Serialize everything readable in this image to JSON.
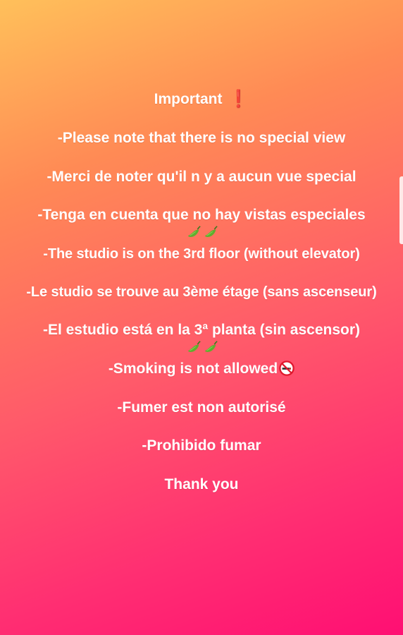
{
  "story": {
    "lines": [
      "Important",
      "-Please note that there is no special view",
      "-Merci de noter qu'il n y a aucun vue special",
      "-Tenga en cuenta que no hay vistas especiales",
      "-The studio is on the 3rd floor (without elevator)",
      "-Le studio se trouve au 3ème étage (sans ascenseur)",
      "-El estudio está en la 3ª planta (sin ascensor)",
      "-Smoking is not allowed",
      "-Fumer est non autorisé",
      "-Prohibido fumar",
      "Thank you"
    ],
    "exclamation_emoji": "❗"
  },
  "icons": {
    "exclamation": "exclamation-mark-icon",
    "peppers": "hot-pepper-icon",
    "no_smoking": "no-smoking-icon"
  },
  "colors": {
    "gradient_top": "#ffc05a",
    "gradient_bottom": "#ff0f73",
    "text": "#ffffff",
    "exclamation": "#d8101a"
  }
}
